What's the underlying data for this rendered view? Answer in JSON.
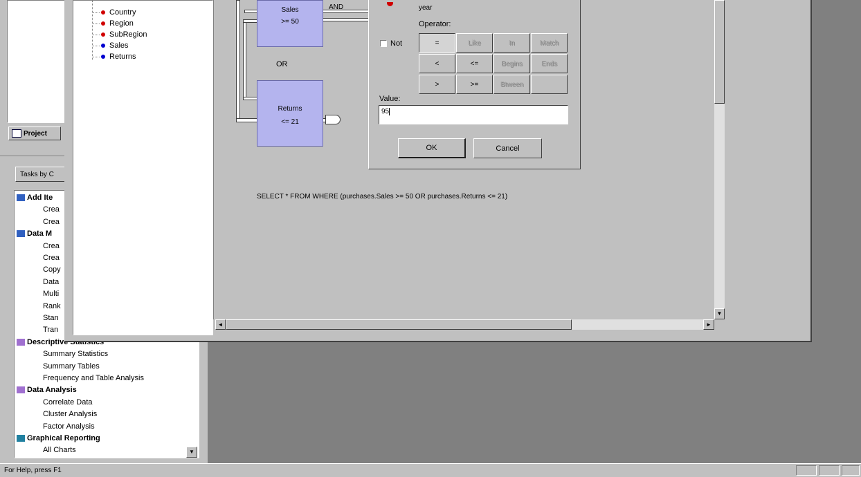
{
  "tree_items": [
    {
      "label": "Country",
      "color": "#d00000"
    },
    {
      "label": "Region",
      "color": "#d00000"
    },
    {
      "label": "SubRegion",
      "color": "#d00000"
    },
    {
      "label": "Sales",
      "color": "#0000d0"
    },
    {
      "label": "Returns",
      "color": "#0000d0"
    }
  ],
  "project_tab": "Project",
  "tasks_tab": "Tasks by C",
  "tasks": [
    {
      "label": "Add Ite",
      "type": "head"
    },
    {
      "label": "Crea",
      "type": "item"
    },
    {
      "label": "Crea",
      "type": "item"
    },
    {
      "label": "Data M",
      "type": "head"
    },
    {
      "label": "Crea",
      "type": "item"
    },
    {
      "label": "Crea",
      "type": "item"
    },
    {
      "label": "Copy",
      "type": "item"
    },
    {
      "label": "Data",
      "type": "item"
    },
    {
      "label": "Multi",
      "type": "item"
    },
    {
      "label": "Rank",
      "type": "item"
    },
    {
      "label": "Stan",
      "type": "item"
    },
    {
      "label": "Tran",
      "type": "item"
    },
    {
      "label": "Descriptive Statistics",
      "type": "head"
    },
    {
      "label": "Summary Statistics",
      "type": "item"
    },
    {
      "label": "Summary Tables",
      "type": "item"
    },
    {
      "label": "Frequency and Table Analysis",
      "type": "item"
    },
    {
      "label": "Data Analysis",
      "type": "head"
    },
    {
      "label": "Correlate Data",
      "type": "item"
    },
    {
      "label": "Cluster Analysis",
      "type": "item"
    },
    {
      "label": "Factor Analysis",
      "type": "item"
    },
    {
      "label": "Graphical Reporting",
      "type": "head"
    },
    {
      "label": "All Charts",
      "type": "item"
    }
  ],
  "diagram": {
    "node_sales_title": "Sales",
    "node_sales_cond": ">= 50",
    "and_label": "AND",
    "or_label": "OR",
    "node_returns_title": "Returns",
    "node_returns_cond": "<= 21"
  },
  "dialog": {
    "year_label": "year",
    "operator_label": "Operator:",
    "not_label": "Not",
    "not_checked": false,
    "operators": [
      {
        "label": "=",
        "enabled": true
      },
      {
        "label": "Like",
        "enabled": false
      },
      {
        "label": "In",
        "enabled": false
      },
      {
        "label": "Match",
        "enabled": false
      },
      {
        "label": "<",
        "enabled": true
      },
      {
        "label": "<=",
        "enabled": true
      },
      {
        "label": "Begins",
        "enabled": false
      },
      {
        "label": "Ends",
        "enabled": false
      },
      {
        "label": ">",
        "enabled": true
      },
      {
        "label": ">=",
        "enabled": true
      },
      {
        "label": "Btween",
        "enabled": false
      },
      {
        "label": "",
        "enabled": false
      }
    ],
    "value_label": "Value:",
    "value": "95",
    "ok_label": "OK",
    "cancel_label": "Cancel"
  },
  "sql": "SELECT * FROM WHERE (purchases.Sales >= 50 OR purchases.Returns <= 21)",
  "status_text": "For Help, press F1",
  "scroll_arrows": {
    "up": "▲",
    "down": "▼",
    "left": "◄",
    "right": "►"
  }
}
